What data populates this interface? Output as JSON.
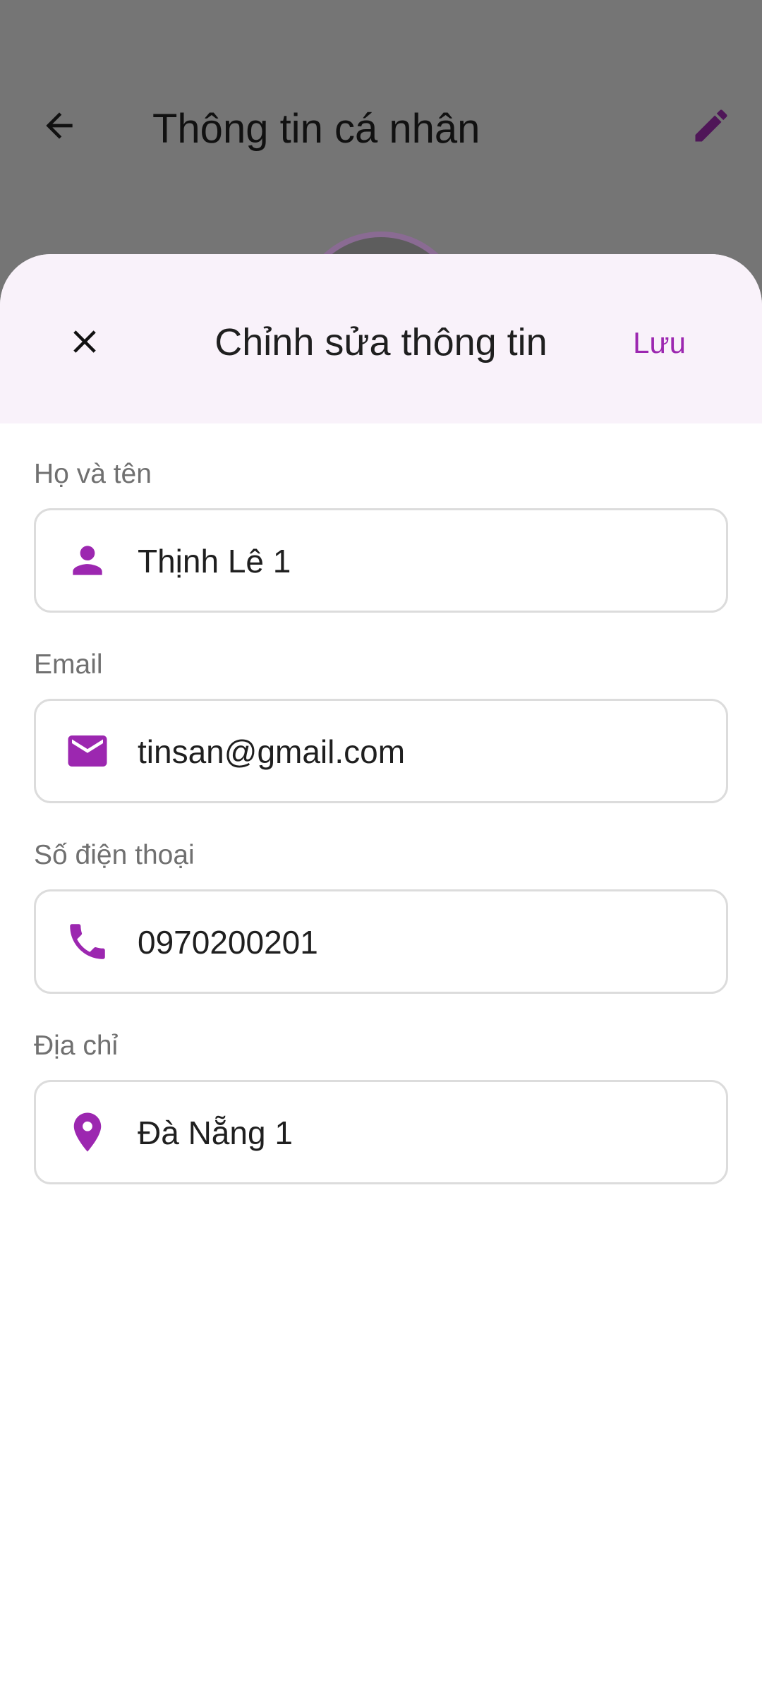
{
  "background": {
    "title": "Thông tin cá nhân"
  },
  "sheet": {
    "title": "Chỉnh sửa thông tin",
    "save_label": "Lưu"
  },
  "fields": [
    {
      "label": "Họ và tên",
      "value": "Thịnh Lê 1",
      "icon": "person-icon"
    },
    {
      "label": "Email",
      "value": "tinsan@gmail.com",
      "icon": "email-icon"
    },
    {
      "label": "Số điện thoại",
      "value": "0970200201",
      "icon": "phone-icon"
    },
    {
      "label": "Địa chỉ",
      "value": "Đà Nẵng 1",
      "icon": "location-pin-icon"
    }
  ],
  "colors": {
    "accent": "#9c27b0",
    "scrim": "#757575",
    "sheet_header": "#f9f2fa"
  }
}
